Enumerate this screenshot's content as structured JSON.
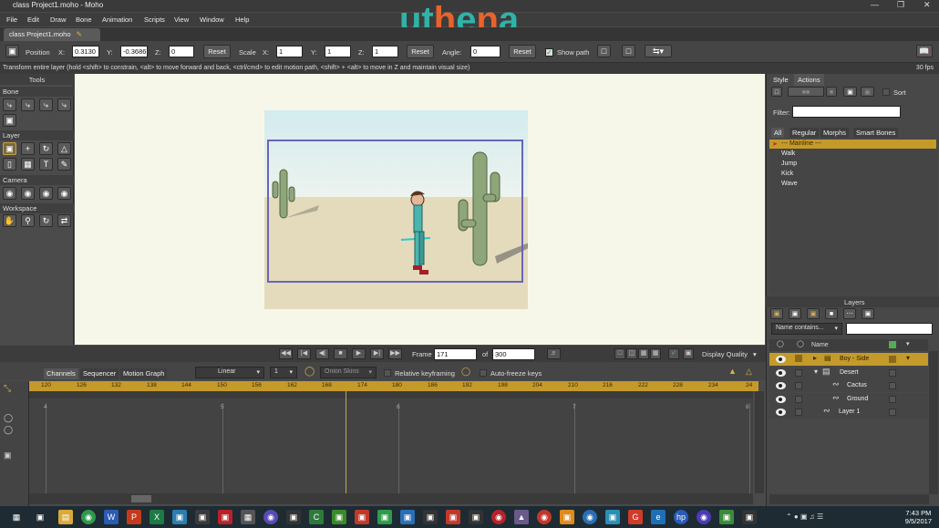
{
  "window": {
    "title": "class Project1.moho - Moho"
  },
  "menu": [
    "File",
    "Edit",
    "Draw",
    "Bone",
    "Animation",
    "Scripts",
    "View",
    "Window",
    "Help"
  ],
  "logo": {
    "text": "uthena",
    "colors": [
      "#2fb3a8",
      "#e8632b"
    ]
  },
  "document_tab": "class Project1.moho",
  "tool_options": {
    "position_label": "Position",
    "x_label": "X:",
    "x_value": "0.3130",
    "y_label": "Y:",
    "y_value": "-0.3686",
    "z_label": "Z:",
    "z_value": "0",
    "reset1": "Reset",
    "scale_label": "Scale",
    "sx_label": "X:",
    "sx_value": "1",
    "sy_label": "Y:",
    "sy_value": "1",
    "sz_label": "Z:",
    "sz_value": "1",
    "reset2": "Reset",
    "angle_label": "Angle:",
    "angle_value": "0",
    "reset3": "Reset",
    "show_path": "Show path"
  },
  "status": {
    "message": "Transform entire layer (hold <shift> to constrain, <alt> to move forward and back, <ctrl/cmd> to edit motion path, <shift> + <alt> to move in Z and maintain visual size)",
    "fps": "30 fps"
  },
  "tools_panel": {
    "title": "Tools",
    "sections": [
      "Bone",
      "Layer",
      "Camera",
      "Workspace"
    ]
  },
  "playback": {
    "frame_label": "Frame",
    "frame_value": "171",
    "of_label": "of",
    "total_frames": "300",
    "display_quality": "Display Quality"
  },
  "timeline": {
    "tabs": [
      "Channels",
      "Sequencer",
      "Motion Graph"
    ],
    "interp": "Linear",
    "interp_num": "1",
    "onion_skins": "Onion Skins",
    "relative_keyframing": "Relative keyframing",
    "auto_freeze": "Auto-freeze keys",
    "ruler": [
      "120",
      "126",
      "132",
      "138",
      "144",
      "150",
      "156",
      "162",
      "168",
      "174",
      "180",
      "186",
      "192",
      "198",
      "204",
      "210",
      "216",
      "222",
      "228",
      "234",
      "24"
    ],
    "grid_labels": [
      "4",
      "5",
      "6",
      "7",
      "8"
    ]
  },
  "right_panel": {
    "tabs": [
      "Style",
      "Actions"
    ],
    "sort": "Sort",
    "filter_label": "Filter:",
    "action_tabs": [
      "All",
      "Regular",
      "Morphs",
      "Smart Bones"
    ],
    "actions": [
      "--- Mainline ---",
      "Walk",
      "Jump",
      "Kick",
      "Wave"
    ],
    "layers_title": "Layers",
    "name_contains": "Name contains...",
    "name_header": "Name",
    "layers": [
      {
        "name": "Boy - Side",
        "indent": 0,
        "selected": true
      },
      {
        "name": "Desert",
        "indent": 1,
        "selected": false
      },
      {
        "name": "Cactus",
        "indent": 2,
        "selected": false
      },
      {
        "name": "Ground",
        "indent": 2,
        "selected": false
      },
      {
        "name": "Layer 1",
        "indent": 1,
        "selected": false
      }
    ]
  },
  "taskbar": {
    "time": "7:43 PM",
    "date": "9/5/2017"
  }
}
